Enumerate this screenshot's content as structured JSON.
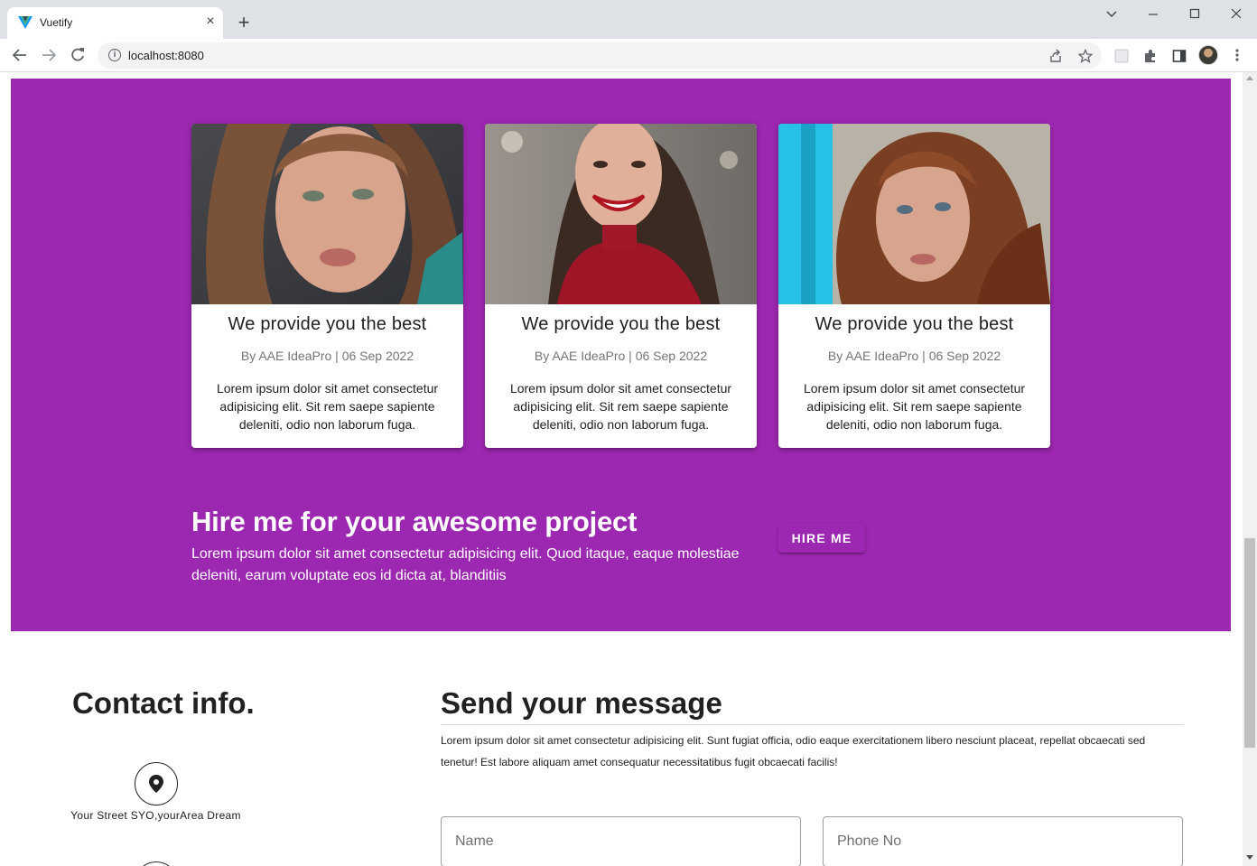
{
  "browser": {
    "tab_title": "Vuetify",
    "tab_close_glyph": "×",
    "new_tab_glyph": "+",
    "url": "localhost:8080",
    "favicon": "vuetify-logo",
    "accent_color": "#41b883"
  },
  "theme": {
    "primary": "#9c27b0"
  },
  "cards": [
    {
      "title": "We provide you the best",
      "meta": "By AAE IdeaPro | 06 Sep 2022",
      "text": "Lorem ipsum dolor sit amet consectetur adipisicing elit. Sit rem saepe sapiente deleniti, odio non laborum fuga."
    },
    {
      "title": "We provide you the best",
      "meta": "By AAE IdeaPro | 06 Sep 2022",
      "text": "Lorem ipsum dolor sit amet consectetur adipisicing elit. Sit rem saepe sapiente deleniti, odio non laborum fuga."
    },
    {
      "title": "We provide you the best",
      "meta": "By AAE IdeaPro | 06 Sep 2022",
      "text": "Lorem ipsum dolor sit amet consectetur adipisicing elit. Sit rem saepe sapiente deleniti, odio non laborum fuga."
    }
  ],
  "hire": {
    "title": "Hire me for your awesome project",
    "text": "Lorem ipsum dolor sit amet consectetur adipisicing elit. Quod itaque, eaque molestiae deleniti, earum voluptate eos id dicta at, blanditiis",
    "button_label": "HIRE ME"
  },
  "contact": {
    "title": "Contact info.",
    "address": "Your Street SYO,yourArea Dream",
    "address_icon": "map-marker-icon"
  },
  "message": {
    "title": "Send your message",
    "text": "Lorem ipsum dolor sit amet consectetur adipisicing elit. Sunt fugiat officia, odio eaque exercitationem libero nesciunt placeat, repellat obcaecati sed tenetur! Est labore aliquam amet consequatur necessitatibus fugit obcaecati facilis!",
    "name_placeholder": "Name",
    "phone_placeholder": "Phone No"
  }
}
